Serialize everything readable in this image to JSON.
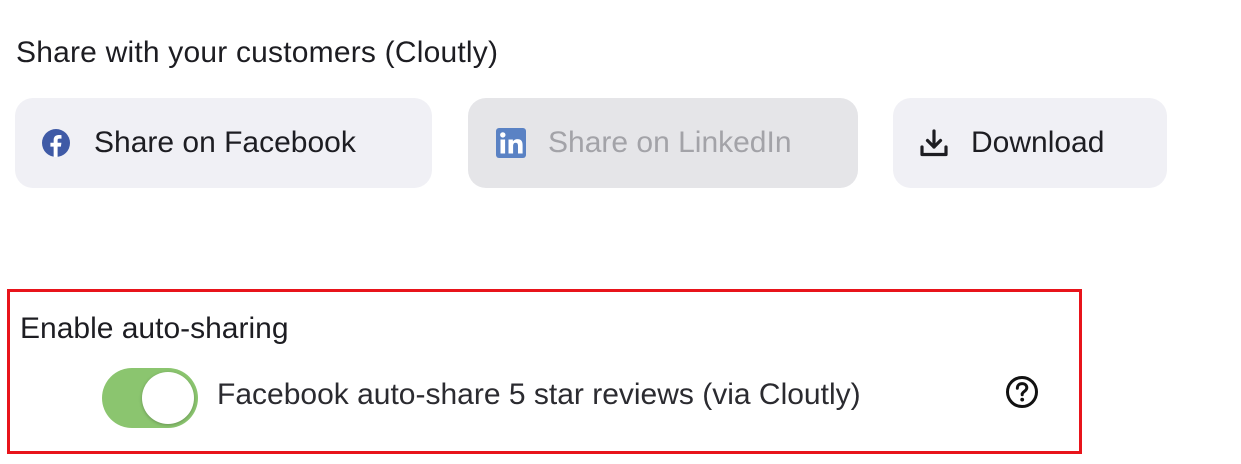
{
  "share_section": {
    "title": "Share with your customers (Cloutly)",
    "buttons": {
      "facebook": {
        "label": "Share on Facebook",
        "icon": "facebook-icon",
        "color": "#3f5aa6"
      },
      "linkedin": {
        "label": "Share on LinkedIn",
        "icon": "linkedin-icon",
        "color": "#5a82c4",
        "disabled": true
      },
      "download": {
        "label": "Download",
        "icon": "download-icon"
      }
    }
  },
  "auto_sharing": {
    "title": "Enable auto-sharing",
    "toggle": {
      "label": "Facebook auto-share 5 star reviews (via Cloutly)",
      "on": true,
      "color": "#8bc56f"
    },
    "help_icon": "help-circle-icon",
    "highlight_color": "#e8141b"
  }
}
